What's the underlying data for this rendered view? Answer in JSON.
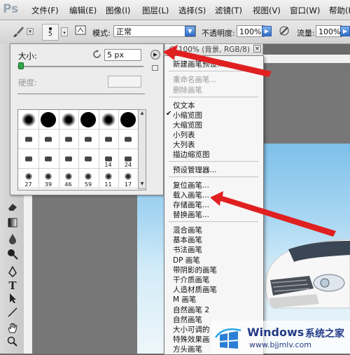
{
  "app": {
    "logo": "Ps"
  },
  "menubar": {
    "items": [
      "文件(F)",
      "编辑(E)",
      "图像(I)",
      "图层(L)",
      "选择(S)",
      "滤镜(T)",
      "视图(V)",
      "窗口(W)",
      "帮助(H)"
    ]
  },
  "options": {
    "brush_size_badge": "5",
    "mode_label": "模式:",
    "mode_value": "正常",
    "opacity_label": "不透明度:",
    "opacity_value": "100%",
    "flow_label": "流量:",
    "flow_value": "100%"
  },
  "document": {
    "tab_title": "@ 100% (背景, RGB/8)",
    "close": "×"
  },
  "brush_panel": {
    "size_label": "大小:",
    "size_value": "5 px",
    "hardness_label": "硬度:",
    "presets": [
      {
        "label": ""
      },
      {
        "label": ""
      },
      {
        "label": ""
      },
      {
        "label": ""
      },
      {
        "label": ""
      },
      {
        "label": ""
      },
      {
        "label": ""
      },
      {
        "label": ""
      },
      {
        "label": ""
      },
      {
        "label": ""
      },
      {
        "label": ""
      },
      {
        "label": ""
      },
      {
        "label": ""
      },
      {
        "label": ""
      },
      {
        "label": ""
      },
      {
        "label": ""
      },
      {
        "label": "14"
      },
      {
        "label": "24"
      },
      {
        "label": "27"
      },
      {
        "label": "39"
      },
      {
        "label": "46"
      },
      {
        "label": "59"
      },
      {
        "label": "11"
      },
      {
        "label": "17"
      }
    ]
  },
  "context_menu": {
    "new_preset": "新建画笔预设...",
    "rename": "重命名画笔...",
    "delete": "删除画笔",
    "text_only": "仅文本",
    "small_thumb": "小缩览图",
    "large_thumb": "大缩览图",
    "small_list": "小列表",
    "large_list": "大列表",
    "stroke_thumb": "描边缩览图",
    "preset_manager": "预设管理器...",
    "reset": "复位画笔...",
    "load": "载入画笔...",
    "save": "存储画笔...",
    "replace": "替换画笔...",
    "sets": [
      "混合画笔",
      "基本画笔",
      "书法画笔",
      "DP 画笔",
      "带阴影的画笔",
      "干介质画笔",
      "人造材质画笔",
      "M 画笔",
      "自然画笔 2",
      "自然画笔",
      "大小可调的",
      "特殊效果画",
      "方头画笔"
    ]
  },
  "watermark": {
    "title": "Windows",
    "title_cn": "系统之家",
    "url": "www.bjjmlv.com"
  },
  "colors": {
    "accent_blue": "#2f6cc6",
    "arrow_red": "#e02020",
    "sky": "#7ec0ea"
  }
}
